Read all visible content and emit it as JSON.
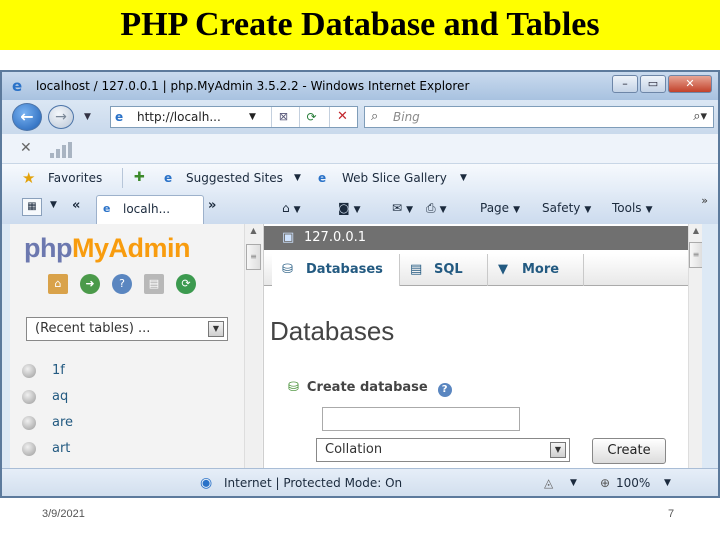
{
  "slide": {
    "title": "PHP Create Database and Tables",
    "date": "3/9/2021",
    "page_number": "7",
    "title_bg": "#ffff00"
  },
  "browser": {
    "window_title": "localhost / 127.0.0.1 | php.MyAdmin 3.5.2.2 - Windows Internet Explorer",
    "address": "http://localh...",
    "search_placeholder": "Bing",
    "favorites_label": "Favorites",
    "suggested_sites": "Suggested Sites",
    "web_slice_gallery": "Web Slice Gallery",
    "active_tab": "localh...",
    "commands": [
      "Page",
      "Safety",
      "Tools"
    ],
    "status_text": "Internet | Protected Mode: On",
    "zoom": "100%",
    "icons": [
      "ie-logo-icon",
      "back-icon",
      "forward-icon",
      "refresh-icon",
      "stop-icon",
      "search-icon",
      "star-icon",
      "home-icon",
      "rss-icon",
      "mail-icon",
      "print-icon",
      "globe-icon",
      "zoom-icon"
    ]
  },
  "pma": {
    "logo": {
      "php": "php",
      "my": "My",
      "admin": "Admin"
    },
    "recent_tables": "(Recent tables) ...",
    "databases": [
      "1f",
      "aq",
      "are",
      "art"
    ],
    "server": "127.0.0.1",
    "tabs": [
      "Databases",
      "SQL",
      "More"
    ],
    "heading": "Databases",
    "create_database_label": "Create database",
    "db_name_value": "",
    "collation": "Collation",
    "create_button": "Create",
    "colors": {
      "php": "#6c78af",
      "my_admin": "#f89c0e",
      "link": "#235a81",
      "server_bar": "#707070"
    }
  }
}
